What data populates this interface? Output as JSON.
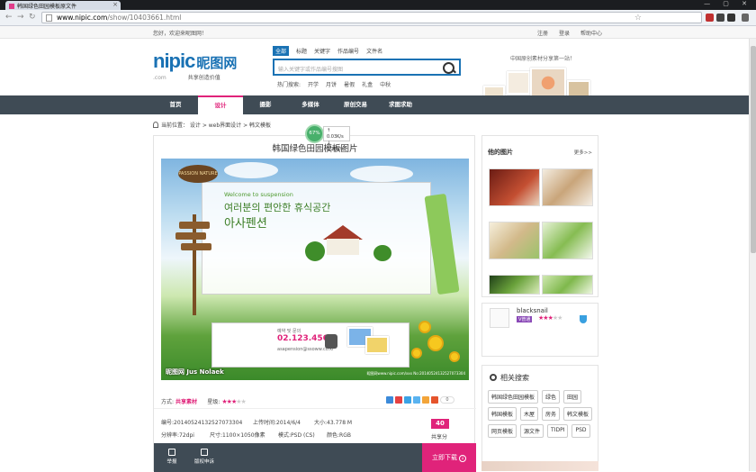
{
  "browser": {
    "tab_title": "韩国绿色田园模板原文件",
    "url_host": "www.nipic.com",
    "url_path": "/show/10403661.html"
  },
  "topbar": {
    "welcome": "您好，欢迎来昵图网！",
    "links": [
      "注册",
      "登录",
      "帮助中心"
    ]
  },
  "header": {
    "logo_en": "nipic",
    "logo_cn": "昵图网",
    "logo_domain": ".com",
    "logo_tagline": "共享创造价值",
    "search_tabs": [
      "全部",
      "标题",
      "关键字",
      "作品编号",
      "文件名"
    ],
    "search_placeholder": "输入关键字或作品编号搜图",
    "hot_label": "热门搜索:",
    "hot_terms": [
      "开学",
      "月饼",
      "暑假",
      "礼盒",
      "中秋"
    ],
    "slogan": "中国原创素材分享第一站！"
  },
  "nav": [
    "首页",
    "设计",
    "摄影",
    "多媒体",
    "原创交易",
    "求图求助"
  ],
  "breadcrumb": "当前位置：  设计  >  web界面设计  >  韩文模板",
  "speed": {
    "percent": "67%",
    "up": "0.03K/s",
    "down": "0.36K/s"
  },
  "detail": {
    "title": "韩国绿色田园模板图片",
    "hero": {
      "sign_tag": "PASSION NATURE",
      "welcome_en": "Welcome to suspension",
      "kr_line1": "여러분의 편안한 휴식공간",
      "kr_line2": "아사펜션",
      "phone_top": "예약 및 문의",
      "phone": "02.123.4567",
      "phone_bottom": "asapension@ssoww.co.kr",
      "watermark": "昵图网 Jus Nolaek",
      "fineprint": "昵图网www.nipic.com/xxx No:20140524132527073304"
    },
    "method_label": "方式:",
    "method_value": "共享素材",
    "rating_label": "星级:",
    "rating": 3,
    "rating_max": 5,
    "share_count": "0",
    "meta": [
      {
        "label": "编号:",
        "value": "20140524132527073304"
      },
      {
        "label": "上传时间:",
        "value": "2014/6/4"
      },
      {
        "label": "大小:",
        "value": "43.778 M"
      },
      {
        "label": "分辨率:",
        "value": "72dpi"
      },
      {
        "label": "尺寸:",
        "value": "1100×1050像素"
      },
      {
        "label": "模式:",
        "value": "PSD (CS)"
      },
      {
        "label": "颜色:",
        "value": "RGB"
      }
    ],
    "points": "40",
    "points_label": "共享分",
    "actions": [
      "举报",
      "版权申诉"
    ],
    "download": "立即下载"
  },
  "sidebar": {
    "his_pics": "他的图片",
    "more": "更多>>",
    "user": {
      "name": "blacksnail",
      "vip": "V普通",
      "rating": 3
    },
    "related_title": "相关搜索",
    "tags": [
      "韩国绿色田园模板",
      "绿色",
      "田园",
      "韩国模板",
      "木屋",
      "房务",
      "韩文模板",
      "网页模板",
      "源文件",
      "TIDPI",
      "PSD"
    ]
  },
  "colors": {
    "accent": "#e0237a",
    "brand_blue": "#1a72b4",
    "nav_bg": "#3f4b55"
  }
}
